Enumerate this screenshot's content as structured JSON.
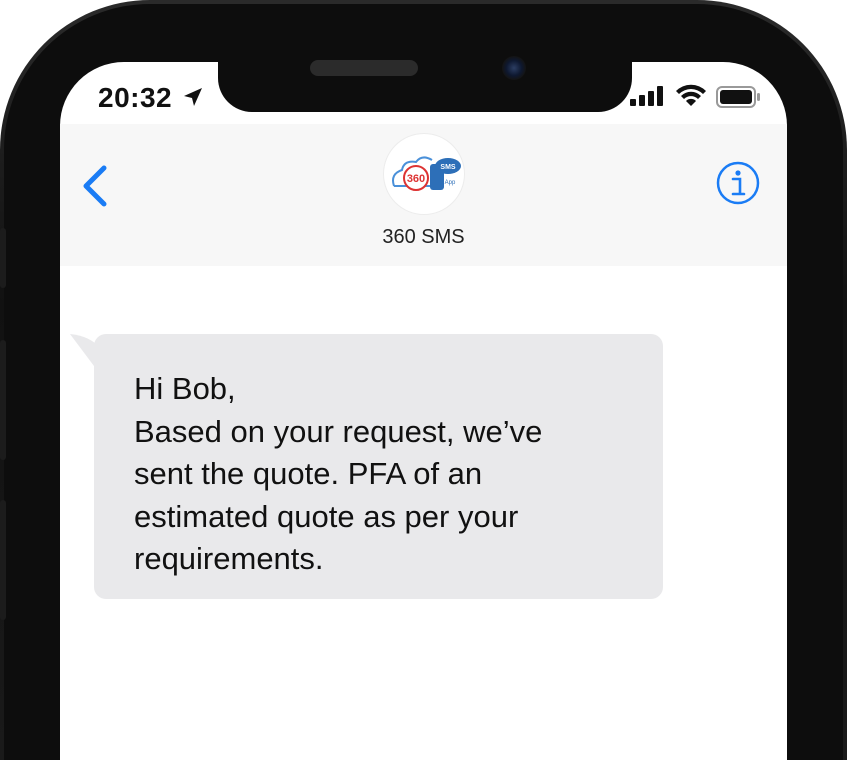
{
  "status_bar": {
    "time": "20:32"
  },
  "header": {
    "contact_name": "360 SMS",
    "avatar_logo": {
      "left_text": "360",
      "badge_top": "SMS",
      "badge_bottom": "App"
    }
  },
  "messages": [
    {
      "direction": "incoming",
      "text": "Hi Bob,\nBased on your request, we’ve\nsent the quote. PFA of an\nestimated quote as per your\nrequirements."
    }
  ],
  "colors": {
    "ios_blue": "#1a7cf5",
    "bubble_gray": "#e9e9eb",
    "header_bg": "#f7f7f7"
  },
  "icons": {
    "back": "chevron-left-icon",
    "info": "info-circle-icon",
    "location": "location-arrow-icon",
    "signal": "cellular-signal-icon",
    "wifi": "wifi-icon",
    "battery": "battery-icon"
  }
}
